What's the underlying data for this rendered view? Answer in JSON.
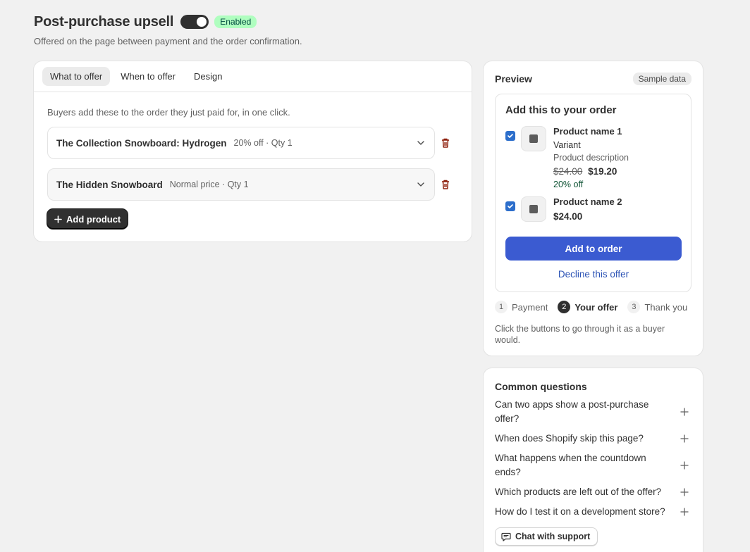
{
  "header": {
    "title": "Post-purchase upsell",
    "status_badge": "Enabled",
    "subtitle": "Offered on the page between payment and the order confirmation."
  },
  "tabs": [
    {
      "label": "What to offer",
      "active": true
    },
    {
      "label": "When to offer",
      "active": false
    },
    {
      "label": "Design",
      "active": false
    }
  ],
  "offer_section": {
    "help": "Buyers add these to the order they just paid for, in one click.",
    "products": [
      {
        "name": "The Collection Snowboard: Hydrogen",
        "meta": "20% off · Qty 1"
      },
      {
        "name": "The Hidden Snowboard",
        "meta": "Normal price · Qty 1"
      }
    ],
    "add_label": "Add product"
  },
  "preview": {
    "title": "Preview",
    "badge": "Sample data",
    "heading": "Add this to your order",
    "items": [
      {
        "name": "Product name 1",
        "variant": "Variant",
        "description": "Product description",
        "old_price": "$24.00",
        "price": "$19.20",
        "discount": "20% off"
      },
      {
        "name": "Product name 2",
        "price": "$24.00"
      }
    ],
    "add_button": "Add to order",
    "decline": "Decline this offer",
    "steps": [
      {
        "num": "1",
        "label": "Payment"
      },
      {
        "num": "2",
        "label": "Your offer"
      },
      {
        "num": "3",
        "label": "Thank you"
      }
    ],
    "hint": "Click the buttons to go through it as a buyer would."
  },
  "faq": {
    "title": "Common questions",
    "questions": [
      "Can two apps show a post-purchase offer?",
      "When does Shopify skip this page?",
      "What happens when the countdown ends?",
      "Which products are left out of the offer?",
      "How do I test it on a development store?"
    ],
    "chat_label": "Chat with support"
  },
  "colors": {
    "accent": "#3b5bd1",
    "enabled_badge": "#affebf",
    "danger": "#8e1f0b"
  }
}
